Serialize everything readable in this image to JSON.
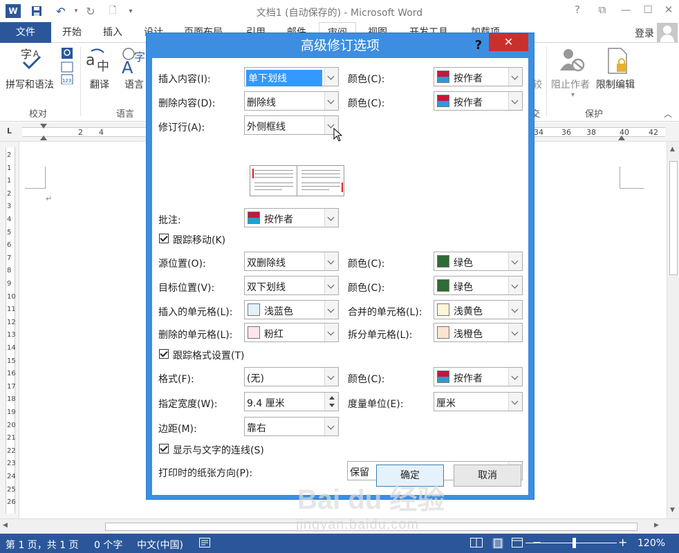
{
  "window": {
    "title": "文档1 (自动保存的) - Microsoft Word",
    "help": "?",
    "min": "—",
    "max": "☐",
    "restore": "⧉",
    "close": "✕"
  },
  "qat": {
    "app_icon": "word-icon",
    "save_icon": "save-icon",
    "undo_icon": "undo-icon",
    "redo_icon": "redo-icon",
    "print_icon": "print-preview-icon",
    "more_icon": "customize-qat-icon"
  },
  "tabs": [
    "文件",
    "开始",
    "插入",
    "设计",
    "页面布局",
    "引用",
    "邮件",
    "审阅",
    "视图",
    "开发工具",
    "加载项"
  ],
  "active_tab": "审阅",
  "login": "登录",
  "ribbon": {
    "spelling_label": "拼写和语法",
    "translate_label": "翻译",
    "language_label": "语言",
    "stop_authors_label": "阻止作者",
    "restrict_edit_label": "限制编辑",
    "group_proofing": "校对",
    "group_language": "语言",
    "group_protect": "保护",
    "group_compare_tail": "较",
    "group_tail2": "交"
  },
  "ruler_numbers": [
    "2",
    "4",
    "34",
    "36",
    "38",
    "40",
    "42"
  ],
  "vruler_numbers": [
    "2",
    "1",
    "1",
    "2",
    "3",
    "4",
    "5",
    "6",
    "7",
    "8",
    "9",
    "10",
    "11",
    "12",
    "13",
    "14",
    "15",
    "16",
    "17",
    "18",
    "19",
    "20",
    "21",
    "22",
    "23",
    "24",
    "25",
    "26"
  ],
  "status": {
    "page": "第 1 页，共 1 页",
    "words": "0 个字",
    "language": "中文(中国)",
    "zoom": "120%"
  },
  "dialog": {
    "title": "高级修订选项",
    "help": "?",
    "close": "✕",
    "insertions_label": "插入内容(I):",
    "insertions_value": "单下划线",
    "insertions_color_label": "颜色(C):",
    "insertions_color_value": "按作者",
    "deletions_label": "删除内容(D):",
    "deletions_value": "删除线",
    "deletions_color_label": "颜色(C):",
    "deletions_color_value": "按作者",
    "changed_lines_label": "修订行(A):",
    "changed_lines_value": "外侧框线",
    "comments_label": "批注:",
    "comments_value": "按作者",
    "track_moves_label": "跟踪移动(K)",
    "moved_from_label": "源位置(O):",
    "moved_from_value": "双删除线",
    "moved_from_color_label": "颜色(C):",
    "moved_from_color_value": "绿色",
    "moved_to_label": "目标位置(V):",
    "moved_to_value": "双下划线",
    "moved_to_color_label": "颜色(C):",
    "moved_to_color_value": "绿色",
    "inserted_cells_label": "插入的单元格(L):",
    "inserted_cells_value": "浅蓝色",
    "merged_cells_label": "合并的单元格(L):",
    "merged_cells_value": "浅黄色",
    "deleted_cells_label": "删除的单元格(L):",
    "deleted_cells_value": "粉红",
    "split_cells_label": "拆分单元格(L):",
    "split_cells_value": "浅橙色",
    "track_formatting_label": "跟踪格式设置(T)",
    "formatting_label": "格式(F):",
    "formatting_value": "(无)",
    "formatting_color_label": "颜色(C):",
    "formatting_color_value": "按作者",
    "width_label": "指定宽度(W):",
    "width_value": "9.4 厘米",
    "measure_label": "度量单位(E):",
    "measure_value": "厘米",
    "margin_label": "边距(M):",
    "margin_value": "靠右",
    "show_lines_label": "显示与文字的连线(S)",
    "paper_orientation_label": "打印时的纸张方向(P):",
    "paper_orientation_value": "保留",
    "ok_label": "确定",
    "cancel_label": "取消"
  },
  "colors": {
    "author_red": "#c4173b",
    "author_blue": "#2b9ad8",
    "green": "#2e6b35",
    "light_blue": "#e3f1fb",
    "light_yellow": "#fff6d8",
    "pink": "#fbe5f0",
    "light_orange": "#fde4d2",
    "word_blue": "#2b579a",
    "dialog_blue": "#3d8ee0"
  },
  "watermark": {
    "logo": "Bai du 经验",
    "url": "jingyan.baidu.com"
  }
}
